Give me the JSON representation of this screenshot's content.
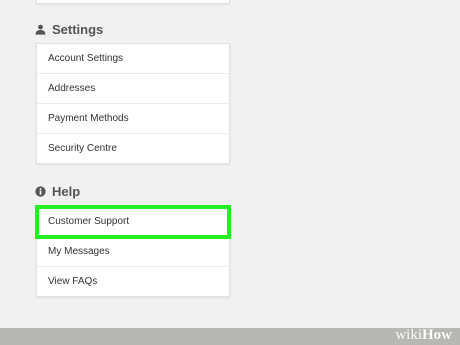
{
  "settings": {
    "title": "Settings",
    "icon": "person-icon",
    "items": [
      {
        "label": "Account Settings"
      },
      {
        "label": "Addresses"
      },
      {
        "label": "Payment Methods"
      },
      {
        "label": "Security Centre"
      }
    ]
  },
  "help": {
    "title": "Help",
    "icon": "info-icon",
    "items": [
      {
        "label": "Customer Support",
        "highlighted": true
      },
      {
        "label": "My Messages"
      },
      {
        "label": "View FAQs"
      }
    ]
  },
  "watermark": {
    "part1": "wiki",
    "part2": "How"
  },
  "colors": {
    "background": "#f1f1f1",
    "highlight": "#24ee24",
    "heading": "#555555",
    "bottom_bar": "#b7b7b3"
  }
}
